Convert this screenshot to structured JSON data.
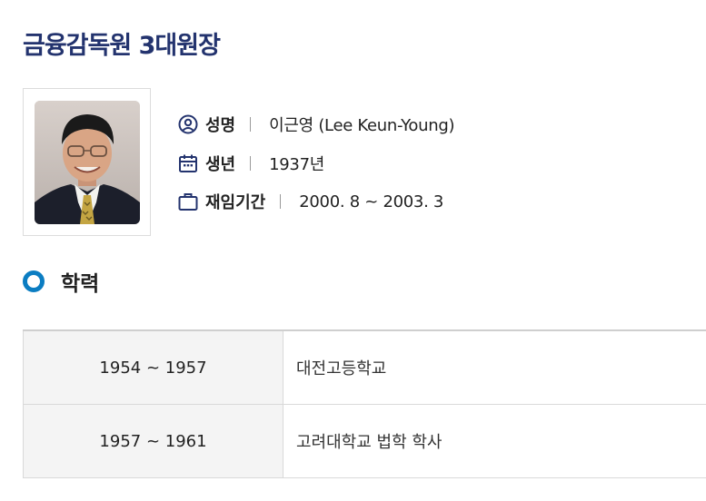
{
  "page": {
    "title": "금융감독원 3대원장"
  },
  "profile": {
    "photo_alt": "이근영 원장 사진",
    "name": {
      "icon": "person-circle-icon",
      "label": "성명",
      "value": "이근영 (Lee Keun-Young)"
    },
    "birth": {
      "icon": "calendar-icon",
      "label": "생년",
      "value": "1937년"
    },
    "term": {
      "icon": "briefcase-icon",
      "label": "재임기간",
      "value": "2000. 8 ~ 2003. 3"
    }
  },
  "education": {
    "title": "학력",
    "rows": [
      {
        "period": "1954 ~ 1957",
        "detail": "대전고등학교"
      },
      {
        "period": "1957 ~ 1961",
        "detail": "고려대학교 법학 학사"
      }
    ]
  },
  "colors": {
    "title": "#23336e",
    "accent": "#0b7dc2",
    "table_label_bg": "#f4f4f4"
  }
}
